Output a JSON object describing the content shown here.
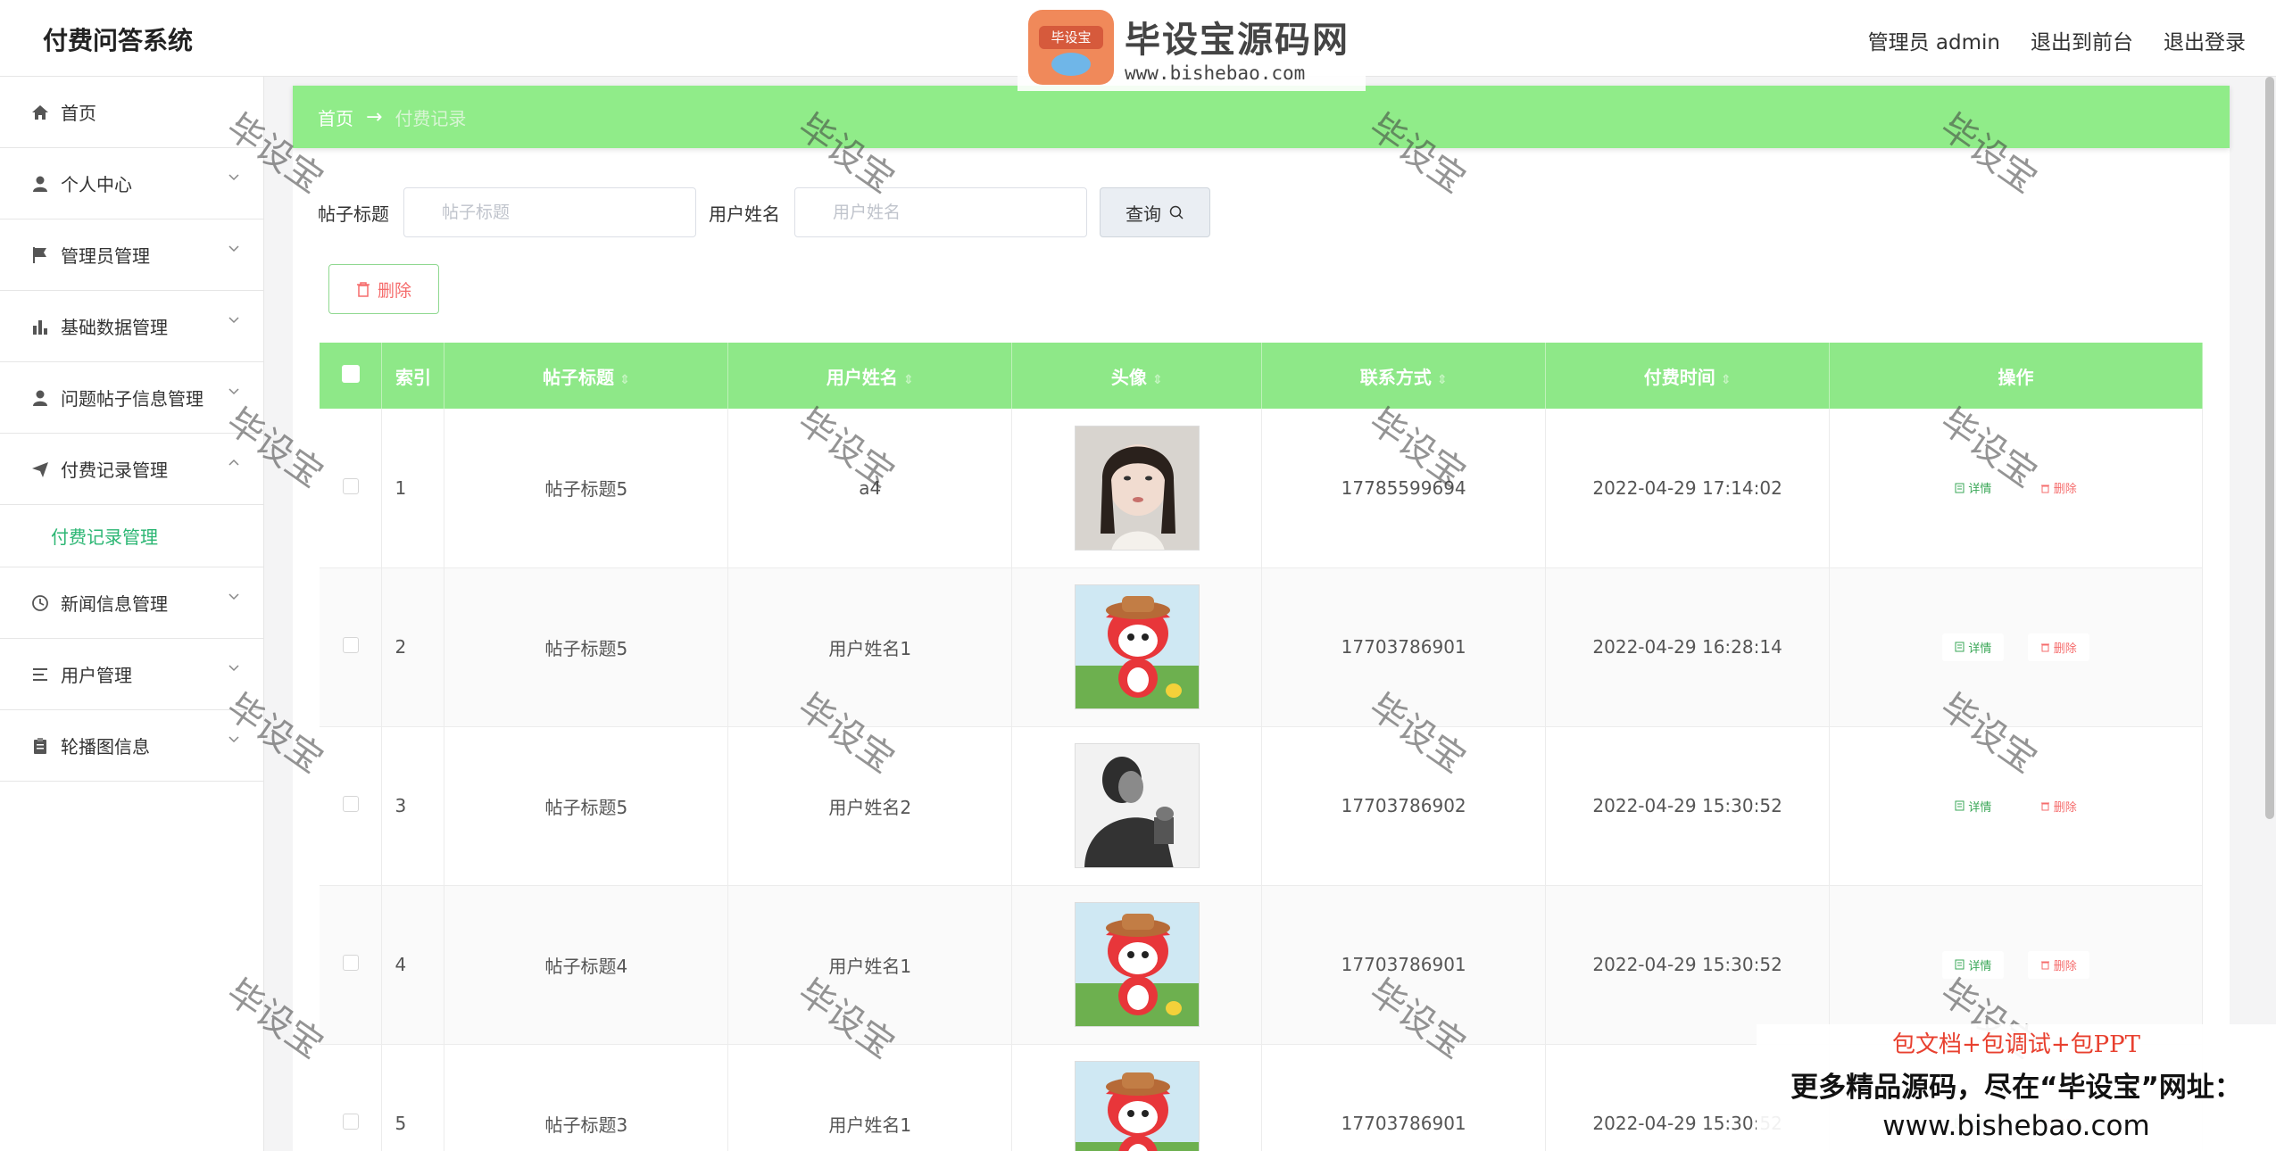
{
  "header": {
    "app_title": "付费问答系统",
    "admin_label": "管理员 admin",
    "front_link": "退出到前台",
    "logout_link": "退出登录"
  },
  "sidebar": {
    "items": [
      {
        "label": "首页",
        "icon": "home-icon"
      },
      {
        "label": "个人中心",
        "icon": "user-icon"
      },
      {
        "label": "管理员管理",
        "icon": "flag-icon"
      },
      {
        "label": "基础数据管理",
        "icon": "bar-chart-icon"
      },
      {
        "label": "问题帖子信息管理",
        "icon": "user-icon"
      },
      {
        "label": "付费记录管理",
        "icon": "send-icon"
      },
      {
        "label": "新闻信息管理",
        "icon": "clock-icon"
      },
      {
        "label": "用户管理",
        "icon": "list-icon"
      },
      {
        "label": "轮播图信息",
        "icon": "clipboard-icon"
      }
    ],
    "submenu_active": "付费记录管理",
    "accent": "#2bb673"
  },
  "breadcrumb": {
    "home": "首页",
    "arrow": "→",
    "current": "付费记录"
  },
  "search": {
    "title_label": "帖子标题",
    "title_placeholder": "帖子标题",
    "user_label": "用户姓名",
    "user_placeholder": "用户姓名",
    "query_label": "查询"
  },
  "toolbar": {
    "delete_label": "删除"
  },
  "table": {
    "headers": {
      "index": "索引",
      "title": "帖子标题",
      "user": "用户姓名",
      "avatar": "头像",
      "contact": "联系方式",
      "time": "付费时间",
      "ops": "操作"
    },
    "detail_label": "详情",
    "delete_label": "删除",
    "rows": [
      {
        "index": "1",
        "title": "帖子标题5",
        "user": "a4",
        "avatar": "woman-photo",
        "contact": "17785599694",
        "time": "2022-04-29 17:14:02"
      },
      {
        "index": "2",
        "title": "帖子标题5",
        "user": "用户姓名1",
        "avatar": "cartoon-fox",
        "contact": "17703786901",
        "time": "2022-04-29 16:28:14"
      },
      {
        "index": "3",
        "title": "帖子标题5",
        "user": "用户姓名2",
        "avatar": "man-photo",
        "contact": "17703786902",
        "time": "2022-04-29 15:30:52"
      },
      {
        "index": "4",
        "title": "帖子标题4",
        "user": "用户姓名1",
        "avatar": "cartoon-fox",
        "contact": "17703786901",
        "time": "2022-04-29 15:30:52"
      },
      {
        "index": "5",
        "title": "帖子标题3",
        "user": "用户姓名1",
        "avatar": "cartoon-fox",
        "contact": "17703786901",
        "time": "2022-04-29 15:30:52"
      }
    ],
    "header_color": "#8ee888"
  },
  "watermark": {
    "text": "毕设宝",
    "logo_name": "毕设宝源码网",
    "logo_url": "www.bishebao.com",
    "logo_badge": "毕设宝"
  },
  "promo": {
    "line1": "包文档+包调试+包PPT",
    "line2": "更多精品源码，尽在“毕设宝”网址：",
    "line3": "www.bishebao.com"
  }
}
